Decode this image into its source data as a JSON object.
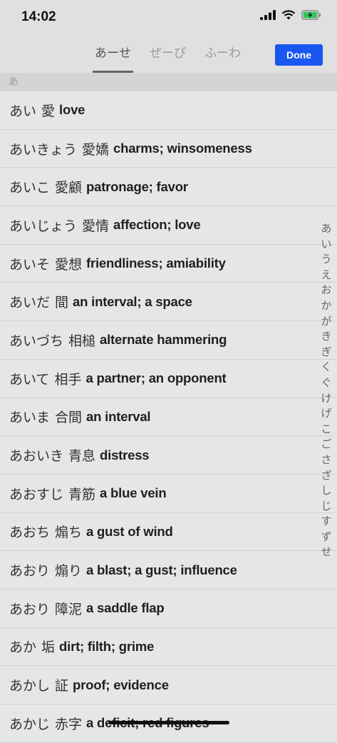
{
  "status": {
    "time": "14:02"
  },
  "tabs": [
    {
      "label": "あーせ",
      "active": true
    },
    {
      "label": "ぜーぴ",
      "active": false
    },
    {
      "label": "ふーわ",
      "active": false
    }
  ],
  "done_label": "Done",
  "section_header": "あ",
  "entries": [
    {
      "kana": "あい",
      "kanji": "愛",
      "def": "love"
    },
    {
      "kana": "あいきょう",
      "kanji": "愛嬌",
      "def": "charms; winsomeness"
    },
    {
      "kana": "あいこ",
      "kanji": "愛顧",
      "def": "patronage; favor"
    },
    {
      "kana": "あいじょう",
      "kanji": "愛情",
      "def": "affection; love"
    },
    {
      "kana": "あいそ",
      "kanji": "愛想",
      "def": "friendliness; amiability"
    },
    {
      "kana": "あいだ",
      "kanji": "間",
      "def": "an interval; a space"
    },
    {
      "kana": "あいづち",
      "kanji": "相槌",
      "def": "alternate hammering"
    },
    {
      "kana": "あいて",
      "kanji": "相手",
      "def": "a partner; an opponent"
    },
    {
      "kana": "あいま",
      "kanji": "合間",
      "def": "an interval"
    },
    {
      "kana": "あおいき",
      "kanji": "青息",
      "def": "distress"
    },
    {
      "kana": "あおすじ",
      "kanji": "青筋",
      "def": "a blue vein"
    },
    {
      "kana": "あおち",
      "kanji": "煽ち",
      "def": "a gust of wind"
    },
    {
      "kana": "あおり",
      "kanji": "煽り",
      "def": "a blast; a gust; influence"
    },
    {
      "kana": "あおり",
      "kanji": "障泥",
      "def": "a saddle flap"
    },
    {
      "kana": "あか",
      "kanji": "垢",
      "def": "dirt; filth; grime"
    },
    {
      "kana": "あかし",
      "kanji": "証",
      "def": "proof; evidence"
    },
    {
      "kana": "あかじ",
      "kanji": "赤字",
      "def": "a deficit; red figures"
    }
  ],
  "index": [
    "あ",
    "い",
    "う",
    "え",
    "お",
    "か",
    "が",
    "き",
    "ぎ",
    "く",
    "ぐ",
    "け",
    "げ",
    "こ",
    "ご",
    "さ",
    "ざ",
    "し",
    "じ",
    "す",
    "ず",
    "せ"
  ],
  "colors": {
    "accent": "#1a56f0",
    "battery": "#35c759"
  }
}
